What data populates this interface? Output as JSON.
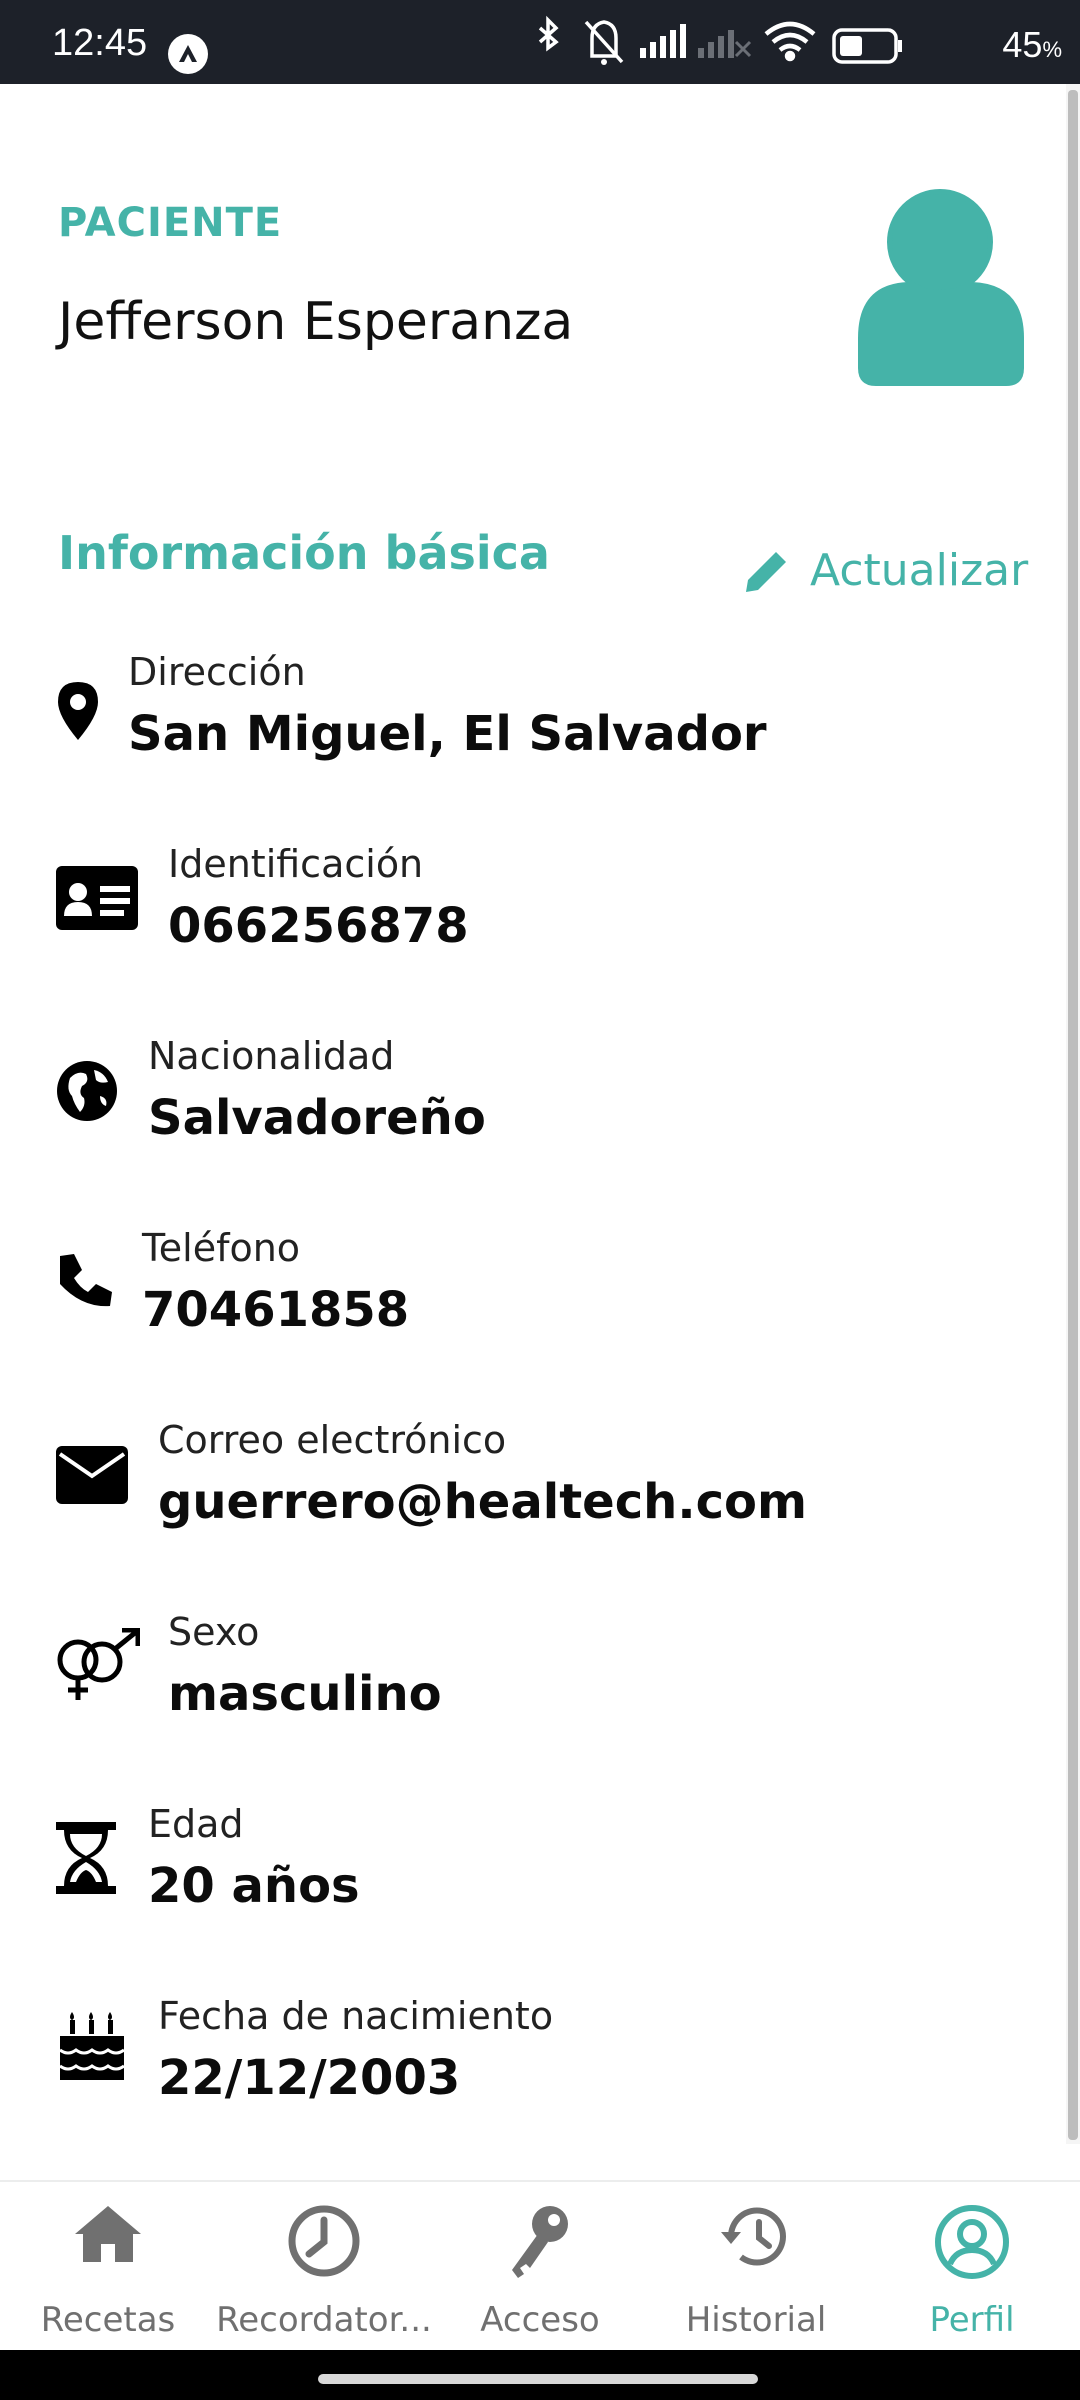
{
  "status_bar": {
    "time": "12:45",
    "battery": "45",
    "battery_unit": "%",
    "icons": [
      "app-notification-icon",
      "bluetooth-icon",
      "mute-icon",
      "signal-icon",
      "signal-x-icon",
      "wifi-icon",
      "battery-icon"
    ]
  },
  "header": {
    "role_label": "PACIENTE",
    "patient_name": "Jefferson Esperanza",
    "avatar_icon": "person-icon"
  },
  "section": {
    "title": "Información básica",
    "update_label": "Actualizar",
    "update_icon": "pencil-icon"
  },
  "info": [
    {
      "label": "Dirección",
      "value": "San Miguel, El Salvador",
      "icon": "map-pin-icon"
    },
    {
      "label": "Identificación",
      "value": "066256878",
      "icon": "id-card-icon"
    },
    {
      "label": "Nacionalidad",
      "value": "Salvadoreño",
      "icon": "globe-icon"
    },
    {
      "label": "Teléfono",
      "value": "70461858",
      "icon": "phone-icon"
    },
    {
      "label": "Correo electrónico",
      "value": "guerrero@healtech.com",
      "icon": "envelope-icon"
    },
    {
      "label": "Sexo",
      "value": "masculino",
      "icon": "gender-icon"
    },
    {
      "label": "Edad",
      "value": "20 años",
      "icon": "hourglass-icon"
    },
    {
      "label": "Fecha de nacimiento",
      "value": "22/12/2003",
      "icon": "birthday-cake-icon"
    }
  ],
  "nav": [
    {
      "label": "Recetas",
      "icon": "home-icon",
      "active": false
    },
    {
      "label": "Recordator...",
      "icon": "clock-icon",
      "active": false
    },
    {
      "label": "Acceso",
      "icon": "key-icon",
      "active": false
    },
    {
      "label": "Historial",
      "icon": "history-icon",
      "active": false
    },
    {
      "label": "Perfil",
      "icon": "profile-icon",
      "active": true
    }
  ],
  "colors": {
    "accent": "#45b3a8",
    "text": "#0c0c0c",
    "nav_inactive": "#707070",
    "status_bar": "#1d2129"
  }
}
